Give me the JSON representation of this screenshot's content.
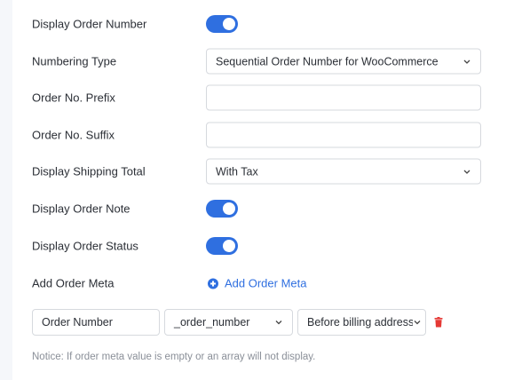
{
  "settings": {
    "display_order_number": {
      "label": "Display Order Number",
      "enabled": true
    },
    "numbering_type": {
      "label": "Numbering Type",
      "value": "Sequential Order Number for WooCommerce"
    },
    "order_no_prefix": {
      "label": "Order No. Prefix",
      "value": ""
    },
    "order_no_suffix": {
      "label": "Order No. Suffix",
      "value": ""
    },
    "display_shipping_total": {
      "label": "Display Shipping Total",
      "value": "With Tax"
    },
    "display_order_note": {
      "label": "Display Order Note",
      "enabled": true
    },
    "display_order_status": {
      "label": "Display Order Status",
      "enabled": true
    },
    "add_order_meta": {
      "label": "Add Order Meta",
      "button_label": "Add Order Meta"
    }
  },
  "order_meta_rows": [
    {
      "name": "Order Number",
      "key": "_order_number",
      "position": "Before billing address"
    }
  ],
  "notice": "Notice: If order meta value is empty or an array will not display.",
  "colors": {
    "accent": "#2f6fe0",
    "danger": "#e53935"
  },
  "icons": {
    "add": "plus-circle-icon",
    "delete": "trash-icon",
    "dropdown": "chevron-down-icon"
  }
}
